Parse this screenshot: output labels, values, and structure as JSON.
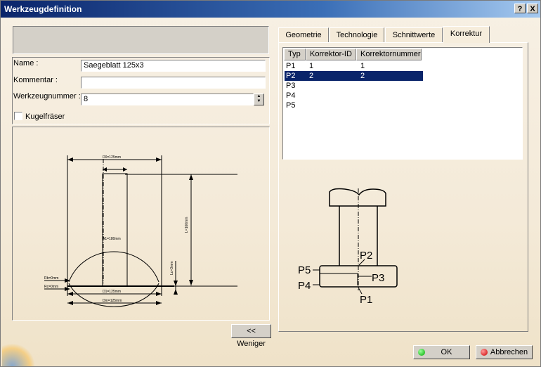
{
  "window": {
    "title": "Werkzeugdefinition",
    "help_btn": "?",
    "close_btn": "X"
  },
  "form": {
    "name_label": "Name :",
    "name_value": "Saegeblatt 125x3",
    "comment_label": "Kommentar :",
    "comment_value": "",
    "toolnum_label": "Werkzeugnummer :",
    "toolnum_value": "8",
    "ball_label": "Kugelfräser"
  },
  "drawing_labels": {
    "d0": "D0=125mm",
    "a1": "A1=180mm",
    "l": "L=160mm",
    "lc": "Lc=3mm",
    "d1": "D1=125mm",
    "dm": "Dm=125mm",
    "rc": "Rc=0mm",
    "rb": "Rb=0mm"
  },
  "tabs": [
    "Geometrie",
    "Technologie",
    "Schnittwerte",
    "Korrektur"
  ],
  "table": {
    "columns": [
      "Typ",
      "Korrektor-ID",
      "Korrektornummer"
    ],
    "rows": [
      [
        "P1",
        "1",
        "1"
      ],
      [
        "P2",
        "2",
        "2"
      ],
      [
        "P3",
        "",
        ""
      ],
      [
        "P4",
        "",
        ""
      ],
      [
        "P5",
        "",
        ""
      ]
    ],
    "selected_row": 1
  },
  "point_labels": {
    "p1": "P1",
    "p2": "P2",
    "p3": "P3",
    "p4": "P4",
    "p5": "P5"
  },
  "buttons": {
    "less": "<< Weniger",
    "ok": "OK",
    "cancel": "Abbrechen"
  }
}
